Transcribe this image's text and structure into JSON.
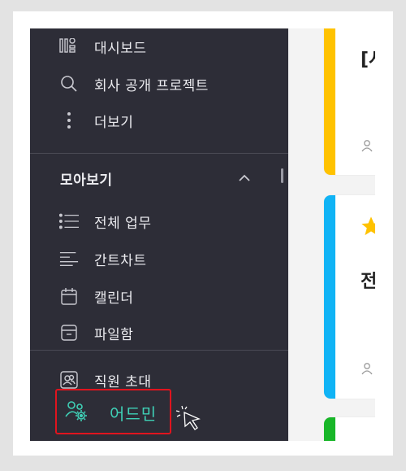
{
  "sidebar": {
    "top_items": [
      {
        "label": "대시보드",
        "icon": "dashboard-icon"
      },
      {
        "label": "회사 공개 프로젝트",
        "icon": "search-icon"
      },
      {
        "label": "더보기",
        "icon": "more-vertical-icon"
      }
    ],
    "section": {
      "title": "모아보기",
      "collapse_icon": "chevron-up-icon"
    },
    "section_items": [
      {
        "label": "전체 업무",
        "icon": "list-icon"
      },
      {
        "label": "간트차트",
        "icon": "gantt-icon"
      },
      {
        "label": "캘린더",
        "icon": "calendar-icon"
      },
      {
        "label": "파일함",
        "icon": "archive-icon"
      }
    ],
    "invite": {
      "label": "직원 초대",
      "icon": "invite-users-icon"
    },
    "admin": {
      "label": "어드민",
      "icon": "admin-users-gear-icon",
      "highlight_color": "#e0141e",
      "label_color": "#3fd0b6"
    }
  },
  "content": {
    "cards": [
      {
        "title_fragment": "[시",
        "stripe_color": "#ffc200"
      },
      {
        "title_fragment": "전",
        "stripe_color": "#10b3f5",
        "starred": true
      },
      {
        "title_fragment": "",
        "stripe_color": "#18b628"
      }
    ]
  },
  "colors": {
    "sidebar_bg": "#2d2d37",
    "accent": "#3fd0b6"
  }
}
